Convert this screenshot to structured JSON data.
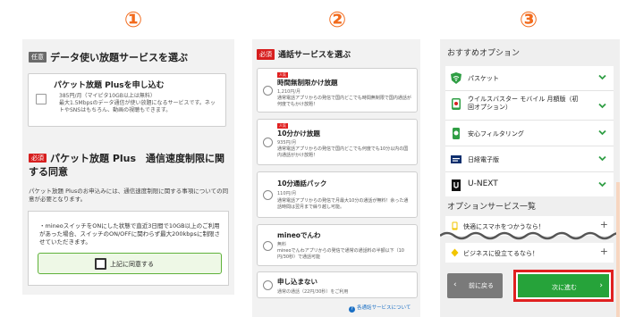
{
  "steps": [
    "①",
    "②",
    "③"
  ],
  "data_plan": {
    "tag": "任意",
    "title": "データ使い放題サービスを選ぶ",
    "option_name": "パケット放題 Plusを申し込む",
    "option_price": "385円/月（マイピタ10GB以上は無料）",
    "option_desc": "最大1.5Mbpsのデータ通信が使い放題になるサービスです。ネットやSNSはもちろん、動画の視聴もできます。"
  },
  "agreement": {
    "tag": "必須",
    "title": "パケット放題 Plus　通信速度制限に関する同意",
    "desc": "パケット放題 Plusのお申込みには、通信速度制限に関する事項についての同意が必要となります。",
    "text": "・mineoスイッチをONにした状態で直近3日間で10GB以上のご利用があった場合、スイッチのON/OFFに関わらず最大200kbpsに制限させていただきます。",
    "agree_label": "上記に同意する"
  },
  "call_service": {
    "tag": "必須",
    "title": "通話サービスを選ぶ",
    "options": [
      {
        "badge": "人気",
        "name": "時間無制限かけ放題",
        "price": "1,210円/月",
        "desc": "通常電話アプリからの発信で国内どこでも時間無制限で国内通話が何度でもかけ放題！"
      },
      {
        "badge": "人気",
        "name": "10分かけ放題",
        "price": "935円/月",
        "desc": "通常電話アプリからの発信で国内どこでも何度でも10分以内の国内通話がかけ放題！"
      },
      {
        "badge": "",
        "name": "10分通話パック",
        "price": "110円/月",
        "desc": "通常電話アプリからの発信で月最大10分の通話が無料！余った通話時間は翌月まで繰り越し可能。"
      },
      {
        "badge": "",
        "name": "mineoでんわ",
        "price": "無料",
        "desc": "mineoでんわアプリからの発信で通常の通話料の半額以下（10円/30秒）で通話可能"
      },
      {
        "badge": "",
        "name": "申し込まない",
        "price": "通常の通話（22円/30秒）をご利用",
        "desc": ""
      }
    ],
    "link": "各通話サービスについて"
  },
  "recommended": {
    "title": "おすすめオプション",
    "items": [
      {
        "icon": "shield-wifi-icon",
        "label": "パスケット"
      },
      {
        "icon": "virus-buster-icon",
        "label": "ウイルスバスター モバイル 月額版（初回オプション）"
      },
      {
        "icon": "filtering-icon",
        "label": "安心フィルタリング"
      },
      {
        "icon": "nikkei-icon",
        "label": "日経電子版"
      },
      {
        "icon": "unext-icon",
        "label": "U-NEXT"
      }
    ]
  },
  "services": {
    "title": "オプションサービス一覧",
    "items": [
      {
        "icon": "phone-comfort-icon",
        "label": "快適にスマホをつかうなら！"
      },
      {
        "icon": "business-icon",
        "label": "ビジネスに役立てるなら！"
      }
    ]
  },
  "nav": {
    "back": "前に戻る",
    "next": "次に進む"
  },
  "colors": {
    "step": "#f26b1d",
    "required": "#d71f1f",
    "accent_green": "#26a33a",
    "highlight": "#e02020"
  }
}
